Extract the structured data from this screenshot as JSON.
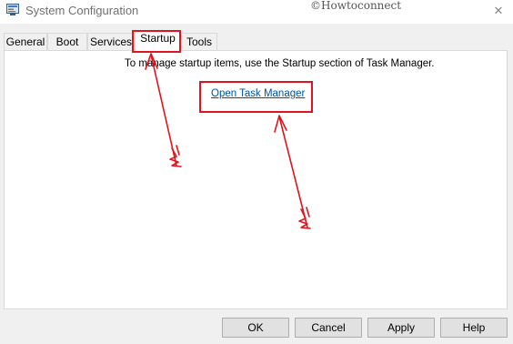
{
  "window": {
    "title": "System Configuration",
    "watermark": "©Howtoconnect",
    "close_glyph": "✕"
  },
  "tabs": [
    {
      "label": "General"
    },
    {
      "label": "Boot"
    },
    {
      "label": "Services"
    },
    {
      "label": "Startup",
      "active": true
    },
    {
      "label": "Tools"
    }
  ],
  "startup": {
    "info_text": "To manage startup items, use the Startup section of Task Manager.",
    "link_text": "Open Task Manager"
  },
  "buttons": {
    "ok": "OK",
    "cancel": "Cancel",
    "apply": "Apply",
    "help": "Help"
  },
  "colors": {
    "annotation": "#e0141e",
    "link": "#0052a3"
  },
  "icons": {
    "app": "msconfig-icon",
    "close": "close-icon"
  }
}
